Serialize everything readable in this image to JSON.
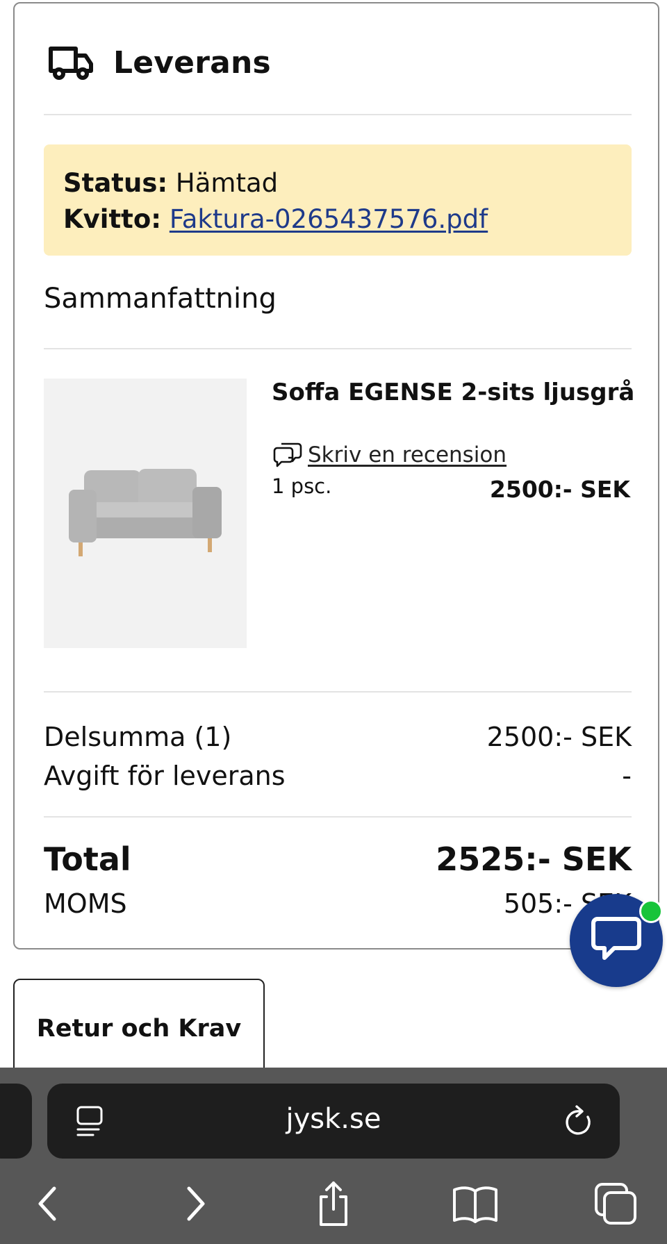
{
  "delivery": {
    "title": "Leverans",
    "status_label": "Status:",
    "status_value": "Hämtad",
    "receipt_label": "Kvitto:",
    "receipt_link": "Faktura-0265437576.pdf"
  },
  "summary": {
    "title": "Sammanfattning"
  },
  "product": {
    "name": "Soffa EGENSE 2-sits ljusgrå",
    "review_link": "Skriv en recension",
    "quantity": "1 psc.",
    "price": "2500:- SEK"
  },
  "totals": {
    "subtotal_label": "Delsumma (1)",
    "subtotal_value": "2500:- SEK",
    "delivery_fee_label": "Avgift för leverans",
    "delivery_fee_value": "-",
    "total_label": "Total",
    "total_value": "2525:- SEK",
    "vat_label": "MOMS",
    "vat_value": "505:- SEK"
  },
  "actions": {
    "return_button": "Retur och Krav"
  },
  "browser": {
    "url": "jysk.se"
  },
  "icons": {
    "delivery": "truck-icon",
    "review": "speech-bubbles-icon",
    "chat": "chat-icon",
    "reader": "reader-mode-icon",
    "reload": "reload-icon",
    "back": "back-icon",
    "forward": "forward-icon",
    "share": "share-icon",
    "bookmarks": "bookmarks-icon",
    "tabs": "tabs-icon"
  },
  "colors": {
    "status_background": "#fdeebd",
    "link": "#1e3a8a",
    "chat_button": "#183b8c",
    "online_dot": "#17c43a",
    "browser_bar": "#575757"
  }
}
